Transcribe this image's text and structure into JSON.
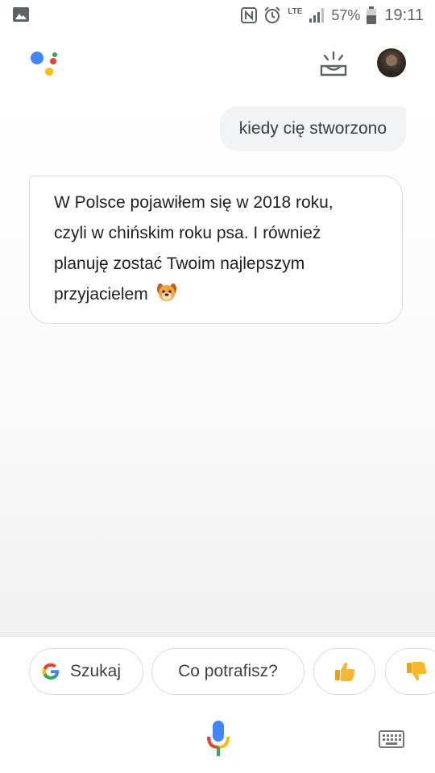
{
  "status_bar": {
    "battery_percent": "57%",
    "time": "19:11",
    "network_label": "LTE",
    "icons": [
      "gallery-icon",
      "nfc-icon",
      "alarm-icon",
      "signal-icon",
      "battery-icon"
    ]
  },
  "header": {
    "icons": [
      "assistant-logo-icon",
      "snapshot-icon",
      "avatar"
    ]
  },
  "conversation": {
    "user_message": "kiedy cię stworzono",
    "assistant_message_lines": [
      "W Polsce pojawiłem się w 2018 roku,",
      "czyli w chińskim roku psa. I również",
      "planuję zostać Twoim najlepszym",
      "przyjacielem"
    ],
    "assistant_emoji": "dog-face-icon"
  },
  "suggestions": {
    "search_label": "Szukaj",
    "capabilities_label": "Co potrafisz?",
    "thumbs_up_icon": "thumbs-up-icon",
    "thumbs_down_icon": "thumbs-down-icon"
  },
  "bottom_bar": {
    "icons": [
      "microphone-icon",
      "keyboard-icon"
    ]
  },
  "colors": {
    "google_blue": "#4285F4",
    "google_red": "#EA4335",
    "google_yellow": "#FBBC05",
    "google_green": "#34A853",
    "bubble_grey": "#f1f3f4",
    "border_grey": "#dadce0"
  }
}
